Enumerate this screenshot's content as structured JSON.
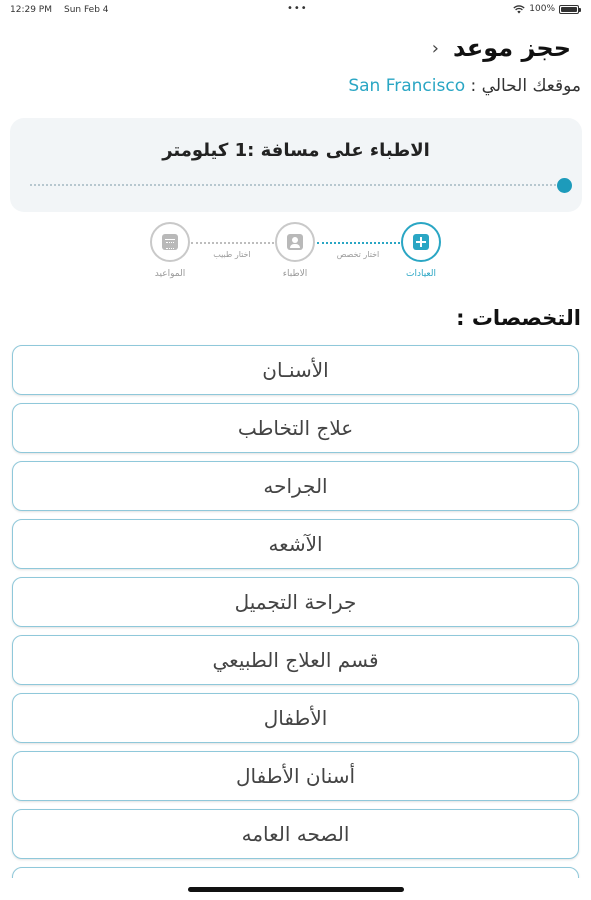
{
  "status_bar": {
    "time": "12:29 PM",
    "date": "Sun Feb 4",
    "dots": "•••",
    "battery": "100%"
  },
  "header": {
    "title": "حجز موعد",
    "back_icon": "chevron-left-icon",
    "back_glyph": "‹"
  },
  "location": {
    "label": "موقعك الحالي :",
    "city": "San Francisco"
  },
  "distance": {
    "label": "الاطباء على مسافة :1 كيلومتر",
    "value_km": 1
  },
  "steps": [
    {
      "label": "العيادات",
      "active": true,
      "icon": "clinic-icon"
    },
    {
      "label": "الاطباء",
      "active": false,
      "icon": "doctor-icon"
    },
    {
      "label": "المواعيد",
      "active": false,
      "icon": "calendar-icon"
    }
  ],
  "step_connectors": [
    {
      "label": "اختار تخصص",
      "active": true
    },
    {
      "label": "اختار طبيب",
      "active": false
    }
  ],
  "specialties": {
    "title": "التخصصات :",
    "items": [
      "الأسنـان",
      "علاج التخاطب",
      "الجراحه",
      "الآشعه",
      "جراحة التجميل",
      "قسم العلاج الطبيعي",
      "الأطفال",
      "أسنان الأطفال",
      "الصحه العامه"
    ]
  },
  "colors": {
    "accent": "#2aa6c4",
    "card_bg": "#f2f5f7",
    "item_border": "#8fc8da"
  }
}
